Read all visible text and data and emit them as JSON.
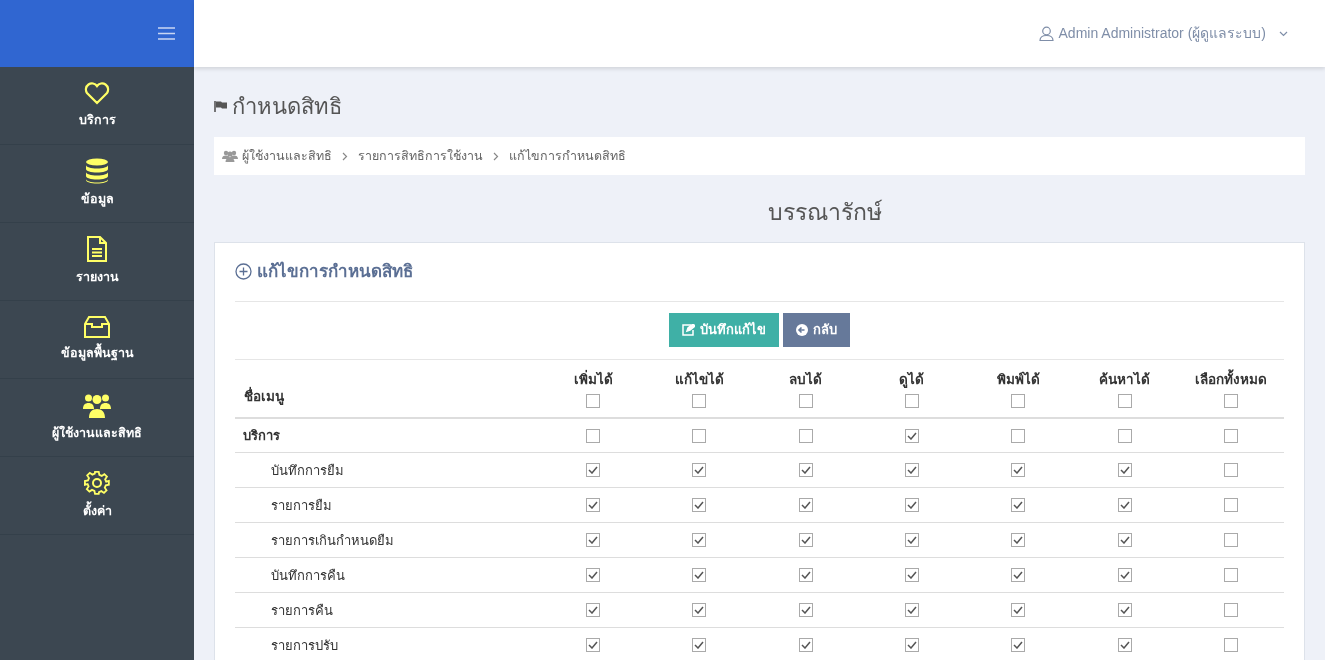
{
  "sidebar": {
    "items": [
      {
        "kind": "heart",
        "label": "บริการ"
      },
      {
        "kind": "database",
        "label": "ข้อมูล"
      },
      {
        "kind": "document",
        "label": "รายงาน"
      },
      {
        "kind": "inbox",
        "label": "ข้อมูลพื้นฐาน"
      },
      {
        "kind": "users",
        "label": "ผู้ใช้งานและสิทธิ"
      },
      {
        "kind": "gear",
        "label": "ตั้งค่า"
      }
    ]
  },
  "top_bar": {
    "user": "Admin Administrator (ผู้ดูแลระบบ)"
  },
  "page_title": "กำหนดสิทธิ",
  "breadcrumb": [
    "ผู้ใช้งานและสิทธิ",
    "รายการสิทธิการใช้งาน",
    "แก้ไขการกำหนดสิทธิ"
  ],
  "role_name": "บรรณารักษ์",
  "panel": {
    "title": "แก้ไขการกำหนดสิทธิ",
    "buttons": [
      {
        "kind": "save",
        "label": "บันทึกแก้ไข"
      },
      {
        "kind": "back",
        "label": "กลับ"
      }
    ]
  },
  "table": {
    "name_column": "ชื่อเมนู",
    "columns": [
      {
        "label": "เพิ่มได้",
        "checked": false
      },
      {
        "label": "แก้ไขได้",
        "checked": false
      },
      {
        "label": "ลบได้",
        "checked": false
      },
      {
        "label": "ดูได้",
        "checked": false
      },
      {
        "label": "พิมพ์ได้",
        "checked": false
      },
      {
        "label": "ค้นหาได้",
        "checked": false
      },
      {
        "label": "เลือกทั้งหมด",
        "checked": false
      }
    ],
    "rows": [
      {
        "kind": "group",
        "name": "บริการ",
        "checked": [
          false,
          false,
          false,
          true,
          false,
          false,
          false
        ]
      },
      {
        "kind": "item",
        "name": "บันทึกการยืม",
        "checked": [
          true,
          true,
          true,
          true,
          true,
          true,
          false
        ]
      },
      {
        "kind": "item",
        "name": "รายการยืม",
        "checked": [
          true,
          true,
          true,
          true,
          true,
          true,
          false
        ]
      },
      {
        "kind": "item",
        "name": "รายการเกินกำหนดยืม",
        "checked": [
          true,
          true,
          true,
          true,
          true,
          true,
          false
        ]
      },
      {
        "kind": "item",
        "name": "บันทึกการคืน",
        "checked": [
          true,
          true,
          true,
          true,
          true,
          true,
          false
        ]
      },
      {
        "kind": "item",
        "name": "รายการคืน",
        "checked": [
          true,
          true,
          true,
          true,
          true,
          true,
          false
        ]
      },
      {
        "kind": "item",
        "name": "รายการปรับ",
        "checked": [
          true,
          true,
          true,
          true,
          true,
          true,
          false
        ]
      }
    ]
  }
}
